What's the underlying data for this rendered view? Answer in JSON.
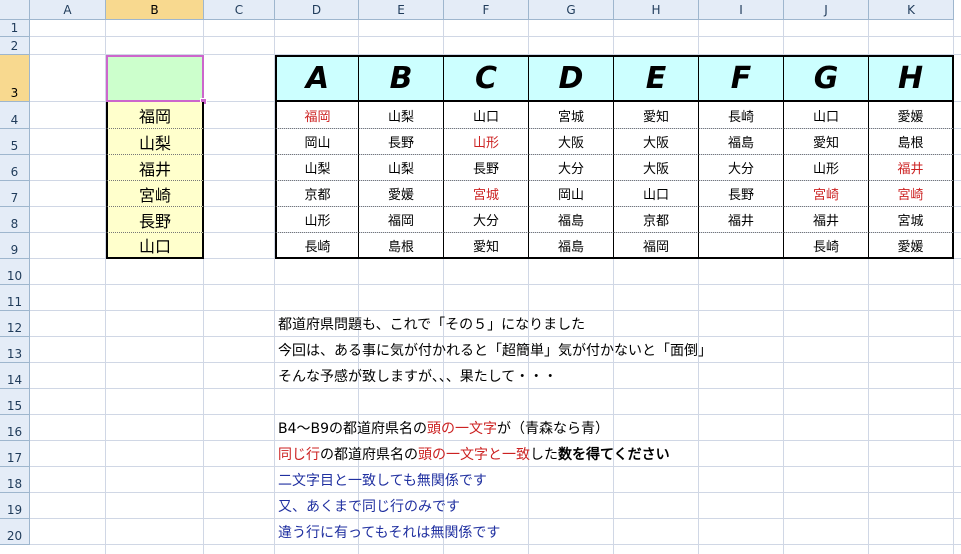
{
  "columns": [
    "A",
    "B",
    "C",
    "D",
    "E",
    "F",
    "G",
    "H",
    "I",
    "J",
    "K"
  ],
  "selected_column": "B",
  "rows": [
    "1",
    "2",
    "3",
    "4",
    "5",
    "6",
    "7",
    "8",
    "9",
    "10",
    "11",
    "12",
    "13",
    "14",
    "15",
    "16",
    "17",
    "18",
    "19",
    "20"
  ],
  "selected_row": "3",
  "b_column": [
    "福岡",
    "山梨",
    "福井",
    "宮崎",
    "長野",
    "山口"
  ],
  "table": {
    "headers": [
      "A",
      "B",
      "C",
      "D",
      "E",
      "F",
      "G",
      "H"
    ],
    "rows": [
      [
        {
          "v": "福岡",
          "red": true
        },
        {
          "v": "山梨"
        },
        {
          "v": "山口"
        },
        {
          "v": "宮城"
        },
        {
          "v": "愛知"
        },
        {
          "v": "長崎"
        },
        {
          "v": "山口"
        },
        {
          "v": "愛媛"
        }
      ],
      [
        {
          "v": "岡山"
        },
        {
          "v": "長野"
        },
        {
          "v": "山形",
          "red": true
        },
        {
          "v": "大阪"
        },
        {
          "v": "大阪"
        },
        {
          "v": "福島"
        },
        {
          "v": "愛知"
        },
        {
          "v": "島根"
        }
      ],
      [
        {
          "v": "山梨"
        },
        {
          "v": "山梨"
        },
        {
          "v": "長野"
        },
        {
          "v": "大分"
        },
        {
          "v": "大阪"
        },
        {
          "v": "大分"
        },
        {
          "v": "山形"
        },
        {
          "v": "福井",
          "red": true
        }
      ],
      [
        {
          "v": "京都"
        },
        {
          "v": "愛媛"
        },
        {
          "v": "宮城",
          "red": true
        },
        {
          "v": "岡山"
        },
        {
          "v": "山口"
        },
        {
          "v": "長野"
        },
        {
          "v": "宮崎",
          "red": true
        },
        {
          "v": "宮崎",
          "red": true
        }
      ],
      [
        {
          "v": "山形"
        },
        {
          "v": "福岡"
        },
        {
          "v": "大分"
        },
        {
          "v": "福島"
        },
        {
          "v": "京都"
        },
        {
          "v": "福井"
        },
        {
          "v": "福井"
        },
        {
          "v": "宮城"
        }
      ],
      [
        {
          "v": "長崎"
        },
        {
          "v": "島根"
        },
        {
          "v": "愛知"
        },
        {
          "v": "福島"
        },
        {
          "v": "福岡"
        },
        {
          "v": ""
        },
        {
          "v": "長崎"
        },
        {
          "v": "愛媛"
        }
      ]
    ]
  },
  "notes": {
    "line12": "都道府県問題も、これで「その５」になりました",
    "line13": "今回は、ある事に気が付かれると「超簡単」気が付かないと「面倒」",
    "line14": "そんな予感が致しますが、、、果たして・・・",
    "line16_a": "B4～B9の都道府県名の",
    "line16_b": "頭の一文字",
    "line16_c": "が（青森なら青）",
    "line17_a": "同じ行",
    "line17_b": "の都道府県名の",
    "line17_c": "頭の一文字と一致",
    "line17_d": "した",
    "line17_e": "数を得てください",
    "line18": "二文字目と一致しても無関係です",
    "line19": "又、あくまで同じ行のみです",
    "line20": "違う行に有ってもそれは無関係です"
  },
  "colors": {
    "highlight_red": "#cc2222",
    "note_blue": "#2030a0",
    "b_fill": "#ffffcc",
    "header_fill": "#ccffff",
    "active_fill": "#ccffcc"
  }
}
